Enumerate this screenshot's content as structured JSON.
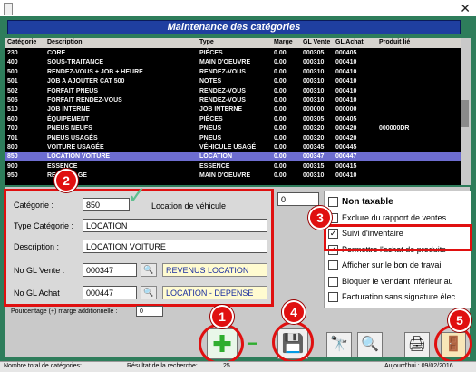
{
  "window": {
    "close_glyph": "✕"
  },
  "banner": {
    "title": "Maintenance des catégories"
  },
  "table": {
    "columns": [
      "Catégorie",
      "Description",
      "Type",
      "Marge",
      "GL Vente",
      "GL Achat",
      "Produit lié"
    ],
    "rows": [
      [
        "230",
        "CORE",
        "PIÈCES",
        "0.00",
        "000305",
        "000405",
        ""
      ],
      [
        "400",
        "SOUS-TRAITANCE",
        "MAIN D'OEUVRE",
        "0.00",
        "000310",
        "000410",
        ""
      ],
      [
        "500",
        "RENDEZ-VOUS + JOB + HEURE",
        "RENDEZ-VOUS",
        "0.00",
        "000310",
        "000410",
        ""
      ],
      [
        "501",
        "JOB A AJOUTER CAT 500",
        "NOTES",
        "0.00",
        "000310",
        "000410",
        ""
      ],
      [
        "502",
        "FORFAIT PNEUS",
        "RENDEZ-VOUS",
        "0.00",
        "000310",
        "000410",
        ""
      ],
      [
        "505",
        "FORFAIT RENDEZ-VOUS",
        "RENDEZ-VOUS",
        "0.00",
        "000310",
        "000410",
        ""
      ],
      [
        "510",
        "JOB INTERNE",
        "JOB INTERNE",
        "0.00",
        "000000",
        "000000",
        ""
      ],
      [
        "600",
        "ÉQUIPEMENT",
        "PIÈCES",
        "0.00",
        "000305",
        "000405",
        ""
      ],
      [
        "700",
        "PNEUS NEUFS",
        "PNEUS",
        "0.00",
        "000320",
        "000420",
        "000000DR"
      ],
      [
        "701",
        "PNEUS USAGÉS",
        "PNEUS",
        "0.00",
        "000320",
        "000420",
        ""
      ],
      [
        "800",
        "VOITURE USAGÉE",
        "VÉHICULE USAGÉ",
        "0.00",
        "000345",
        "000445",
        ""
      ],
      [
        "850",
        "LOCATION VOITURE",
        "LOCATION",
        "0.00",
        "000347",
        "000447",
        ""
      ],
      [
        "900",
        "ESSENCE",
        "ESSENCE",
        "0.00",
        "000315",
        "000415",
        ""
      ],
      [
        "950",
        "RECYCLAGE",
        "MAIN D'OEUVRE",
        "0.00",
        "000310",
        "000410",
        ""
      ]
    ],
    "selected_index": 11
  },
  "form": {
    "categorie_label": "Catégorie :",
    "categorie_value": "850",
    "categorie_desc": "Location de véhicule",
    "type_label": "Type Catégorie :",
    "type_value": "LOCATION",
    "description_label": "Description :",
    "description_value": "LOCATION VOITURE",
    "gl_vente_label": "No GL Vente :",
    "gl_vente_value": "000347",
    "gl_vente_ref": "REVENUS LOCATION",
    "gl_achat_label": "No GL Achat :",
    "gl_achat_value": "000447",
    "gl_achat_ref": "LOCATION - DEPENSE",
    "pourcentage_label": "Pourcentage (+) marge additionnelle :",
    "pourcentage_value": "0",
    "hidden_value": "0"
  },
  "options": [
    {
      "label": "Non taxable",
      "checked": false,
      "bold": true
    },
    {
      "label": "Exclure du rapport de ventes",
      "checked": false,
      "bold": false
    },
    {
      "label": "Suivi d'inventaire",
      "checked": true,
      "bold": false
    },
    {
      "label": "Permettre l'achat de produits",
      "checked": true,
      "bold": false
    },
    {
      "label": "Afficher sur le bon de travail",
      "checked": false,
      "bold": false
    },
    {
      "label": "Bloquer le vendant inférieur au",
      "checked": false,
      "bold": false
    },
    {
      "label": "Facturation sans signature élec",
      "checked": false,
      "bold": false
    }
  ],
  "markers": [
    "1",
    "2",
    "3",
    "4",
    "5"
  ],
  "toolbar": {
    "add_glyph": "✚",
    "minus_glyph": "−",
    "save_glyph": "💾",
    "binoculars_glyph": "🔭",
    "search_glyph": "🔍",
    "print_glyph": "🖨",
    "exit_glyph": "🚪"
  },
  "status": {
    "total_label": "Nombre total de catégories:",
    "search_label": "Résultat de la recherche:",
    "search_value": "25",
    "today_label": "Aujourd'hui : 09/02/2016"
  },
  "colors": {
    "accent_red": "#e01010",
    "banner_blue": "#1f3fa0",
    "selected_row": "#6d6dd0",
    "frame_green": "#2e7d5b"
  }
}
